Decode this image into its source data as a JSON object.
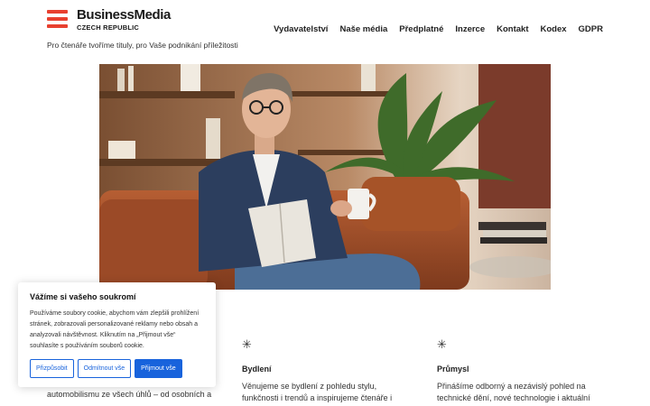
{
  "brand": {
    "name": "BusinessMedia",
    "subtitle": "CZECH REPUBLIC",
    "tagline": "Pro čtenáře tvoříme tituly, pro Vaše podnikání příležitosti"
  },
  "nav": {
    "items": [
      "Vydavatelství",
      "Naše média",
      "Předplatné",
      "Inzerce",
      "Kontakt",
      "Kodex",
      "GDPR"
    ]
  },
  "sections": [
    {
      "title": "Bydlení",
      "text": "Věnujeme se bydlení z pohledu stylu, funkčnosti i trendů a inspirujeme čtenáře i"
    },
    {
      "title": "Průmysl",
      "text": "Přinášíme odborný a nezávislý pohled na technické dění, nové technologie i aktuální"
    }
  ],
  "partial_text": "automobilismu ze všech úhlů – od osobních a",
  "cookie": {
    "title": "Vážíme si vašeho soukromí",
    "body": "Používáme soubory cookie, abychom vám zlepšili prohlížení stránek, zobrazovali personalizované reklamy nebo obsah a analyzovali návštěvnost. Kliknutím na „Přijmout vše“ souhlasíte s používáním souborů cookie.",
    "customize": "Přizpůsobit",
    "reject": "Odmítnout vše",
    "accept": "Přijmout vše"
  },
  "colors": {
    "brand_red": "#e8402f",
    "accent_blue": "#1863dc"
  },
  "icons": {
    "section_icon": "asterisk-star-icon"
  }
}
